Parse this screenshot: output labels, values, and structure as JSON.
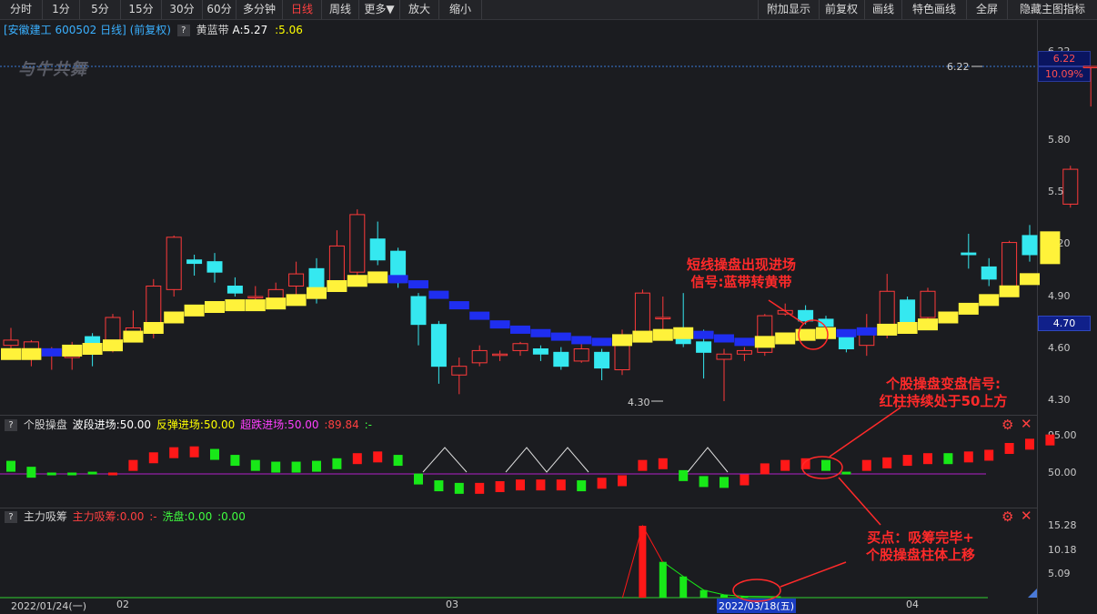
{
  "toolbar": {
    "left": [
      "分时",
      "1分",
      "5分",
      "15分",
      "30分",
      "60分",
      "多分钟",
      "日线",
      "周线",
      "更多▼",
      "放大",
      "缩小"
    ],
    "right": [
      "附加显示",
      "前复权",
      "画线",
      "特色画线",
      "全屏",
      "隐藏主图指标"
    ]
  },
  "stock": {
    "title": "[安徽建工 600502 日线] (前复权)",
    "indicator_name": "黄蓝带",
    "indicator_a": "A:5.27",
    "indicator_b": ":5.06",
    "logo_text": "与牛共舞"
  },
  "price_axis": {
    "labels": [
      "6.22",
      "5.80",
      "5.50",
      "5.20",
      "4.90",
      "4.60",
      "4.30"
    ],
    "last_price": "6.22",
    "last_pct": "10.09%",
    "mark_price": "4.70",
    "high_label": "6.22",
    "low_label": "4.30"
  },
  "panel2": {
    "q": "?",
    "name": "个股操盘",
    "t1": "波段进场:50.00",
    "t2": "反弹进场:50.00",
    "t3": "超跌进场:50.00",
    "t4": ":89.84",
    "t5": ":-",
    "y_labels": [
      "95.00",
      "50.00"
    ]
  },
  "panel3": {
    "q": "?",
    "name": "主力吸筹",
    "t1": "主力吸筹:0.00",
    "t2": ":-",
    "t3": "洗盘:0.00",
    "t4": ":0.00",
    "y_labels": [
      "15.28",
      "10.18",
      "5.09"
    ]
  },
  "x_axis": {
    "start_date": "2022/01/24(一)",
    "cursor_date": "2022/03/18(五)",
    "month_labels": [
      "02",
      "03",
      "04"
    ]
  },
  "annotations": {
    "a1_line1": "短线操盘出现进场",
    "a1_line2": "信号:蓝带转黄带",
    "a2_line1": "个股操盘变盘信号:",
    "a2_line2": "红柱持续处于50上方",
    "a3_line1": "买点：吸筹完毕+",
    "a3_line2": "个股操盘柱体上移"
  },
  "chart_data": {
    "type": "candlestick",
    "ylim": [
      4.25,
      6.3
    ],
    "candles": [
      [
        4.62,
        4.65,
        4.72,
        4.57
      ],
      [
        4.58,
        4.64,
        4.65,
        4.5
      ],
      [
        4.57,
        4.6,
        4.61,
        4.48
      ],
      [
        4.55,
        4.62,
        4.64,
        4.48
      ],
      [
        4.67,
        4.59,
        4.69,
        4.5
      ],
      [
        4.65,
        4.78,
        4.8,
        4.58
      ],
      [
        4.68,
        4.72,
        4.82,
        4.65
      ],
      [
        4.7,
        4.96,
        5.0,
        4.66
      ],
      [
        4.94,
        5.24,
        5.25,
        4.9
      ],
      [
        5.11,
        5.09,
        5.14,
        5.02
      ],
      [
        5.1,
        5.04,
        5.15,
        4.98
      ],
      [
        4.96,
        4.92,
        5.01,
        4.9
      ],
      [
        4.9,
        4.9,
        4.96,
        4.85
      ],
      [
        4.89,
        4.94,
        4.98,
        4.85
      ],
      [
        4.96,
        5.03,
        5.1,
        4.9
      ],
      [
        5.06,
        4.91,
        5.12,
        4.86
      ],
      [
        4.98,
        5.19,
        5.28,
        4.95
      ],
      [
        5.04,
        5.37,
        5.4,
        4.98
      ],
      [
        5.23,
        5.11,
        5.33,
        5.08
      ],
      [
        5.16,
        4.98,
        5.18,
        4.95
      ],
      [
        4.9,
        4.74,
        4.92,
        4.62
      ],
      [
        4.74,
        4.5,
        4.76,
        4.4
      ],
      [
        4.45,
        4.5,
        4.55,
        4.34
      ],
      [
        4.52,
        4.59,
        4.62,
        4.5
      ],
      [
        4.57,
        4.57,
        4.59,
        4.53
      ],
      [
        4.59,
        4.63,
        4.64,
        4.56
      ],
      [
        4.6,
        4.57,
        4.62,
        4.53
      ],
      [
        4.58,
        4.5,
        4.61,
        4.48
      ],
      [
        4.53,
        4.6,
        4.63,
        4.52
      ],
      [
        4.58,
        4.49,
        4.6,
        4.42
      ],
      [
        4.48,
        4.63,
        4.71,
        4.45
      ],
      [
        4.68,
        4.92,
        4.94,
        4.68
      ],
      [
        4.78,
        4.78,
        4.9,
        4.7
      ],
      [
        4.71,
        4.63,
        4.92,
        4.61
      ],
      [
        4.64,
        4.58,
        4.71,
        4.43
      ],
      [
        4.54,
        4.57,
        4.6,
        4.3
      ],
      [
        4.57,
        4.59,
        4.61,
        4.53
      ],
      [
        4.58,
        4.79,
        4.8,
        4.56
      ],
      [
        4.8,
        4.82,
        4.86,
        4.79
      ],
      [
        4.82,
        4.76,
        4.85,
        4.74
      ],
      [
        4.77,
        4.73,
        4.79,
        4.71
      ],
      [
        4.69,
        4.6,
        4.71,
        4.58
      ],
      [
        4.62,
        4.71,
        4.8,
        4.56
      ],
      [
        4.7,
        4.93,
        5.03,
        4.66
      ],
      [
        4.88,
        4.75,
        4.9,
        4.74
      ],
      [
        4.78,
        4.93,
        4.95,
        4.76
      ],
      [
        null,
        null,
        null,
        null
      ],
      [
        5.15,
        5.14,
        5.26,
        5.06
      ],
      [
        5.07,
        5.0,
        5.12,
        4.96
      ],
      [
        4.93,
        5.21,
        5.22,
        4.92
      ],
      [
        5.25,
        5.14,
        5.31,
        5.1
      ],
      [
        null,
        null,
        null,
        null
      ],
      [
        5.43,
        5.63,
        5.65,
        5.41
      ],
      [
        6.22,
        6.22,
        6.22,
        5.99
      ]
    ],
    "band": [
      [
        4.57,
        "y"
      ],
      [
        4.57,
        "y"
      ],
      [
        4.58,
        "b"
      ],
      [
        4.59,
        "y"
      ],
      [
        4.6,
        "y"
      ],
      [
        4.62,
        "y"
      ],
      [
        4.67,
        "y"
      ],
      [
        4.72,
        "y"
      ],
      [
        4.78,
        "y"
      ],
      [
        4.82,
        "y"
      ],
      [
        4.84,
        "y"
      ],
      [
        4.85,
        "y"
      ],
      [
        4.85,
        "y"
      ],
      [
        4.86,
        "y"
      ],
      [
        4.88,
        "y"
      ],
      [
        4.92,
        "y"
      ],
      [
        4.96,
        "y"
      ],
      [
        4.99,
        "y"
      ],
      [
        5.01,
        "y"
      ],
      [
        5.0,
        "b"
      ],
      [
        4.97,
        "b"
      ],
      [
        4.91,
        "b"
      ],
      [
        4.85,
        "b"
      ],
      [
        4.79,
        "b"
      ],
      [
        4.74,
        "b"
      ],
      [
        4.71,
        "b"
      ],
      [
        4.69,
        "b"
      ],
      [
        4.67,
        "b"
      ],
      [
        4.65,
        "b"
      ],
      [
        4.64,
        "b"
      ],
      [
        4.65,
        "y"
      ],
      [
        4.67,
        "y"
      ],
      [
        4.68,
        "y"
      ],
      [
        4.69,
        "y"
      ],
      [
        4.68,
        "b"
      ],
      [
        4.66,
        "b"
      ],
      [
        4.64,
        "b"
      ],
      [
        4.64,
        "y"
      ],
      [
        4.66,
        "y"
      ],
      [
        4.68,
        "y"
      ],
      [
        4.69,
        "y"
      ],
      [
        4.69,
        "b"
      ],
      [
        4.7,
        "b"
      ],
      [
        4.71,
        "y"
      ],
      [
        4.72,
        "y"
      ],
      [
        4.74,
        "y"
      ],
      [
        4.78,
        "y"
      ],
      [
        4.83,
        "y"
      ],
      [
        4.88,
        "y"
      ],
      [
        4.93,
        "y"
      ],
      [
        5.0,
        "y"
      ],
      [
        5.18,
        "y"
      ]
    ],
    "panel2_ylim": [
      30,
      110
    ],
    "panel2_bars": [
      [
        59,
        "g"
      ],
      [
        52,
        "g"
      ],
      [
        50,
        "g"
      ],
      [
        50,
        "g"
      ],
      [
        51,
        "g"
      ],
      [
        50,
        "r"
      ],
      [
        60,
        "r"
      ],
      [
        69,
        "r"
      ],
      [
        75,
        "r"
      ],
      [
        76,
        "r"
      ],
      [
        73,
        "g"
      ],
      [
        66,
        "g"
      ],
      [
        60,
        "g"
      ],
      [
        58,
        "g"
      ],
      [
        58,
        "g"
      ],
      [
        59,
        "g"
      ],
      [
        62,
        "g"
      ],
      [
        68,
        "r"
      ],
      [
        70,
        "r"
      ],
      [
        66,
        "g"
      ],
      [
        44,
        "g"
      ],
      [
        36,
        "g"
      ],
      [
        33,
        "g"
      ],
      [
        33,
        "r"
      ],
      [
        35,
        "r"
      ],
      [
        37,
        "r"
      ],
      [
        37,
        "r"
      ],
      [
        37,
        "r"
      ],
      [
        36,
        "g"
      ],
      [
        39,
        "r"
      ],
      [
        42,
        "r"
      ],
      [
        60,
        "r"
      ],
      [
        62,
        "r"
      ],
      [
        48,
        "g"
      ],
      [
        41,
        "g"
      ],
      [
        40,
        "g"
      ],
      [
        43,
        "r"
      ],
      [
        56,
        "r"
      ],
      [
        60,
        "r"
      ],
      [
        62,
        "r"
      ],
      [
        60,
        "g"
      ],
      [
        51,
        "g"
      ],
      [
        60,
        "r"
      ],
      [
        63,
        "r"
      ],
      [
        66,
        "r"
      ],
      [
        68,
        "r"
      ],
      [
        68,
        "g"
      ],
      [
        70,
        "r"
      ],
      [
        72,
        "r"
      ],
      [
        80,
        "r"
      ],
      [
        85,
        "r"
      ],
      [
        90,
        "r"
      ]
    ],
    "panel3_ylim": [
      0,
      16
    ],
    "panel3_bars": [
      [
        31,
        "r",
        15.28
      ],
      [
        32,
        "g",
        7.6
      ],
      [
        33,
        "g",
        4.5
      ],
      [
        34,
        "g",
        1.6
      ],
      [
        35,
        "g",
        0.6
      ],
      [
        36,
        "g",
        0.3
      ]
    ]
  }
}
